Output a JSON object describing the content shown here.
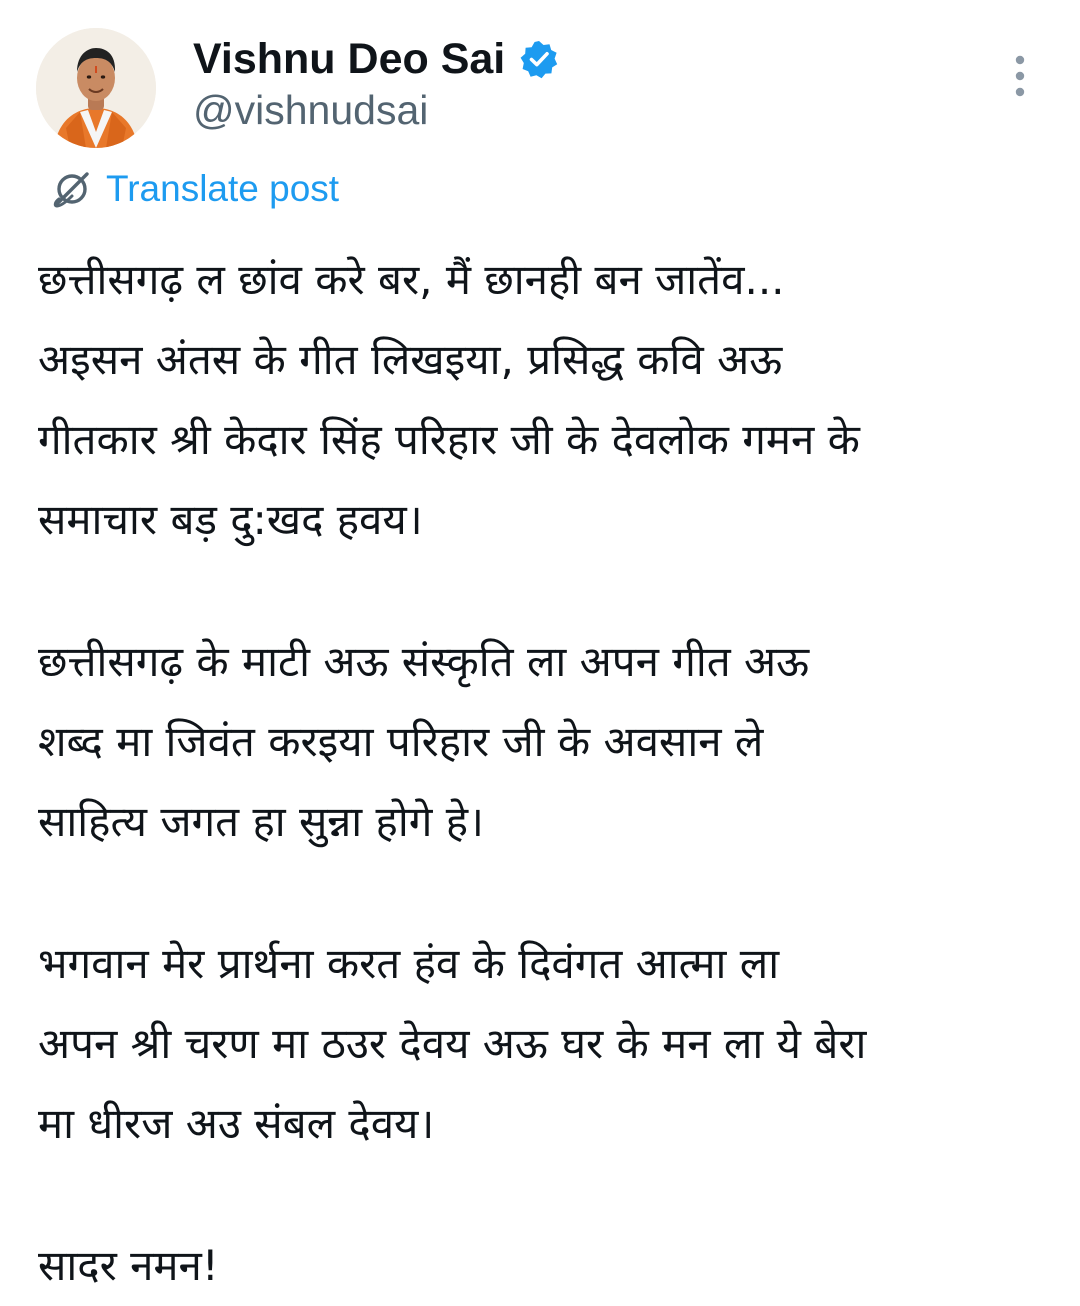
{
  "author": {
    "display_name": "Vishnu Deo Sai",
    "handle": "@vishnudsai",
    "verified": true,
    "verified_icon": "verified-badge-icon",
    "avatar_icon": "profile-photo"
  },
  "actions": {
    "more_icon": "vertical-ellipsis-icon",
    "translate_label": "Translate post",
    "translate_icon": "translate-globe-icon"
  },
  "colors": {
    "text": "#0f1419",
    "secondary": "#536471",
    "accent": "#1d9bf0"
  },
  "post": {
    "paragraphs": [
      {
        "lines": [
          "छत्तीसगढ़ ल छांव करे बर, मैं छानही बन जातेंव...",
          "अइसन अंतस के गीत लिखइया, प्रसिद्ध कवि अऊ",
          "गीतकार श्री केदार सिंह परिहार जी के देवलोक गमन के",
          "समाचार बड़ दु:खद हवय।"
        ]
      },
      {
        "lines": [
          "छत्तीसगढ़ के माटी अऊ संस्कृति ला अपन गीत अऊ",
          "शब्द मा जिवंत करइया परिहार जी के अवसान ले",
          "साहित्य जगत हा सुन्ना होगे हे।"
        ]
      },
      {
        "lines": [
          "भगवान मेर प्रार्थना करत हंव के दिवंगत आत्मा ला",
          "अपन श्री चरण मा ठउर देवय अऊ घर के मन ला ये बेरा",
          "मा धीरज अउ संबल देवय।"
        ]
      },
      {
        "lines": [
          "सादर नमन!"
        ]
      }
    ]
  }
}
